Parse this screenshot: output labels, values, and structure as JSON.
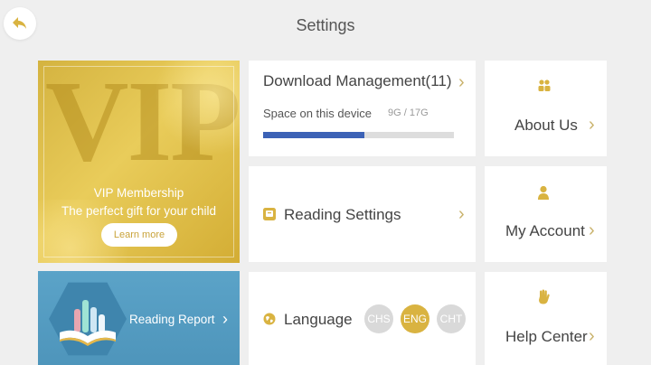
{
  "header": {
    "title": "Settings",
    "back_icon": "back-arrow-icon"
  },
  "vip": {
    "bg_text": "VIP",
    "line1": "VIP Membership",
    "line2": "The perfect gift for your child",
    "button": "Learn more"
  },
  "report": {
    "label": "Reading Report",
    "chevron": "›"
  },
  "download": {
    "title": "Download Management(11)",
    "chevron": "›",
    "space_label": "Space on this device",
    "space_value": "9G / 17G",
    "progress": 0.53
  },
  "reading_settings": {
    "label": "Reading Settings",
    "chevron": "›"
  },
  "language": {
    "label": "Language",
    "options": [
      "CHS",
      "ENG",
      "CHT"
    ],
    "selected": "ENG"
  },
  "about": {
    "label": "About Us",
    "chevron": "›"
  },
  "account": {
    "label": "My Account",
    "chevron": "›"
  },
  "help": {
    "label": "Help Center",
    "chevron": "›"
  },
  "colors": {
    "accent_gold": "#d9b341",
    "progress_blue": "#3c62b6",
    "report_blue": "#5ba3c8"
  }
}
